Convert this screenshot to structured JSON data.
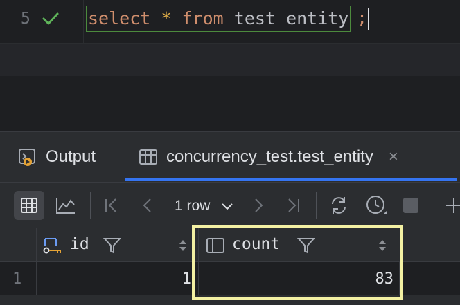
{
  "editor": {
    "line_number": "5",
    "code": {
      "kw_select": "select",
      "star": "*",
      "kw_from": "from",
      "table": "test_entity",
      "semicolon": ";"
    }
  },
  "tabs": [
    {
      "label": "Output",
      "icon": "console-icon"
    },
    {
      "label": "concurrency_test.test_entity",
      "icon": "table-icon",
      "close": "×"
    }
  ],
  "toolbar": {
    "row_count": "1 row"
  },
  "table": {
    "columns": [
      {
        "name": "id",
        "icon": "primary-key-icon"
      },
      {
        "name": "count",
        "icon": "column-icon"
      }
    ],
    "rows": [
      {
        "row_number": "1",
        "id": "1",
        "count": "83"
      }
    ]
  },
  "colors": {
    "accent": "#3574f0",
    "highlight": "#f3f0a3",
    "keyword": "#cf8e6d",
    "success": "#5fb45a"
  }
}
